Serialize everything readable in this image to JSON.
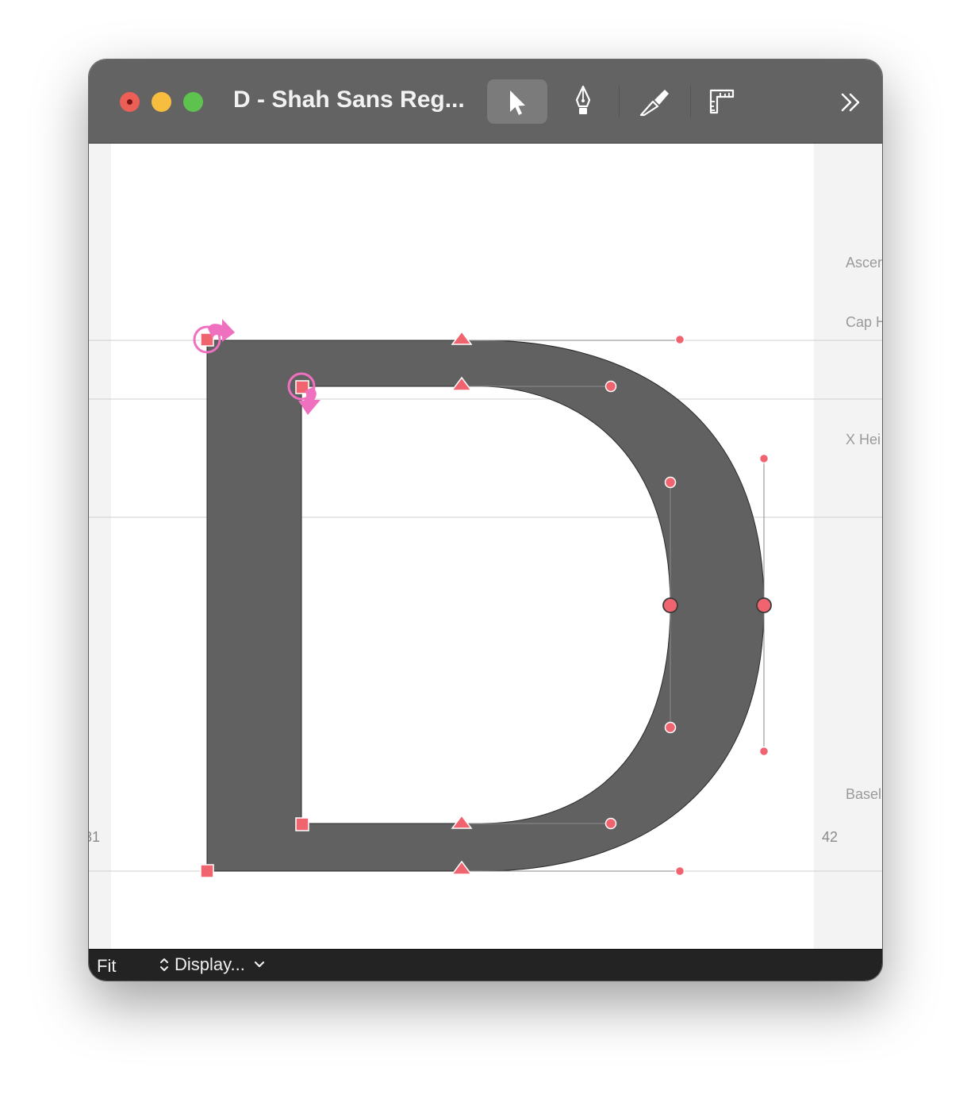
{
  "window": {
    "title": "D - Shah Sans Reg..."
  },
  "toolbar": {
    "tools": [
      {
        "name": "select-tool",
        "icon": "arrow-pointer-icon",
        "active": true
      },
      {
        "name": "pen-tool",
        "icon": "pen-nib-icon",
        "active": false
      },
      {
        "name": "knife-tool",
        "icon": "knife-icon",
        "active": false
      },
      {
        "name": "measure-tool",
        "icon": "ruler-icon",
        "active": false
      }
    ],
    "overflow_icon": "double-chevron-right-icon"
  },
  "metrics": {
    "ascender": "Ascer",
    "cap_height": "Cap H",
    "x_height": "X Hei",
    "baseline": "Basel"
  },
  "sidebearings": {
    "left": "31",
    "right": "42"
  },
  "bottombar": {
    "zoom": "Fit",
    "display_menu": "Display..."
  },
  "colors": {
    "titlebar": "#636363",
    "glyph_fill": "#616161",
    "node": "#f06470",
    "start_point": "#f070c0",
    "bottombar": "#232323"
  }
}
